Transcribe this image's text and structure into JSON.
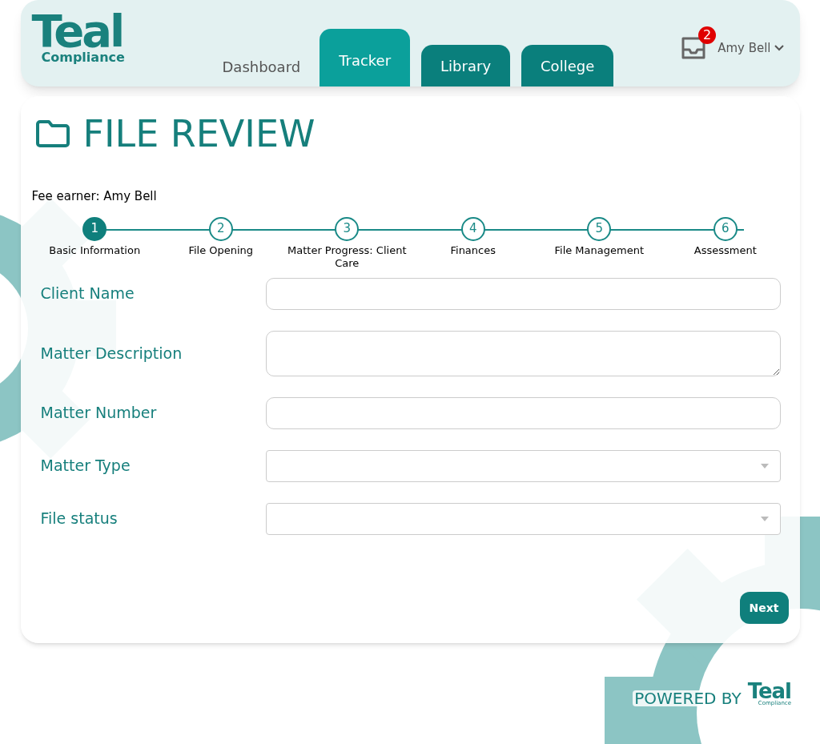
{
  "logo": {
    "name": "Teal",
    "subtitle": "Compliance"
  },
  "tabs": [
    {
      "label": "Dashboard",
      "kind": "link",
      "selected": false
    },
    {
      "label": "Tracker",
      "kind": "tab",
      "selected": true
    },
    {
      "label": "Library",
      "kind": "tab",
      "selected": false
    },
    {
      "label": "College",
      "kind": "tab",
      "selected": false
    }
  ],
  "notifications": {
    "count": "2"
  },
  "user": {
    "name": "Amy Bell"
  },
  "page": {
    "title": "FILE REVIEW",
    "fee_earner": "Fee earner: Amy Bell"
  },
  "steps": [
    {
      "number": "1",
      "label": "Basic Information",
      "selected": true
    },
    {
      "number": "2",
      "label": "File Opening",
      "selected": false
    },
    {
      "number": "3",
      "label": "Matter Progress: Client Care",
      "selected": false
    },
    {
      "number": "4",
      "label": "Finances",
      "selected": false
    },
    {
      "number": "5",
      "label": "File Management",
      "selected": false
    },
    {
      "number": "6",
      "label": "Assessment",
      "selected": false
    }
  ],
  "fields": [
    {
      "label": "Client Name",
      "kind": "text"
    },
    {
      "label": "Matter Description",
      "kind": "textarea"
    },
    {
      "label": "Matter Number",
      "kind": "text"
    },
    {
      "label": "Matter Type",
      "kind": "select"
    },
    {
      "label": "File status",
      "kind": "select"
    }
  ],
  "next_button": "Next",
  "footer": {
    "powered_by": "POWERED BY",
    "logo_name": "Teal",
    "logo_subtitle": "Compliance"
  }
}
